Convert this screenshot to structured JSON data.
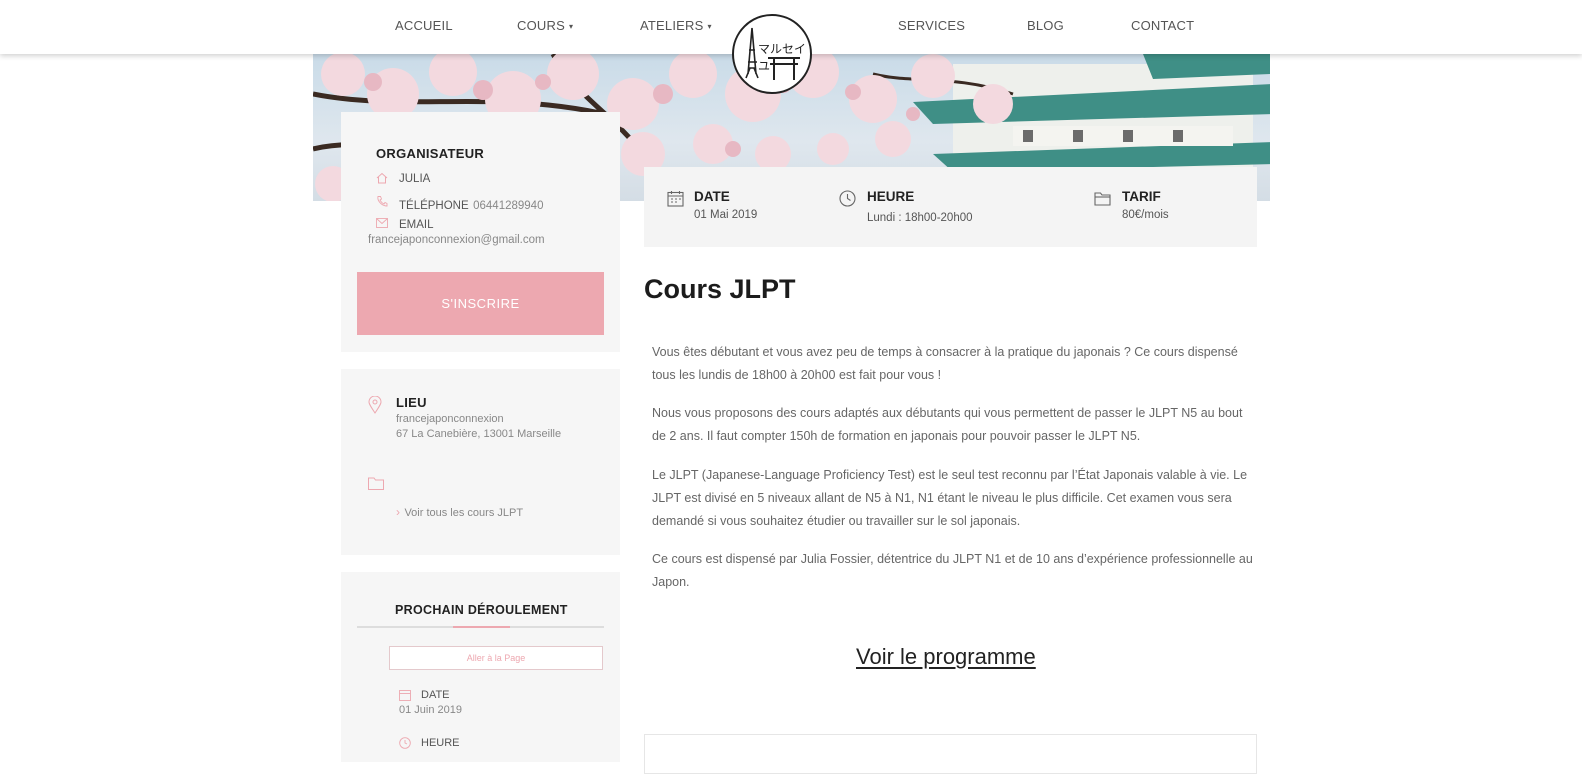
{
  "nav": {
    "items": [
      {
        "label": "ACCUEIL"
      },
      {
        "label": "COURS",
        "dropdown": true
      },
      {
        "label": "ATELIERS",
        "dropdown": true
      },
      {
        "label": "SERVICES"
      },
      {
        "label": "BLOG"
      },
      {
        "label": "CONTACT"
      }
    ],
    "caret": "▾"
  },
  "logo": {
    "text": "マルセイユ"
  },
  "organizer": {
    "heading": "ORGANISATEUR",
    "name": "JULIA",
    "phone_label": "TÉLÉPHONE",
    "phone_value": "06441289940",
    "email_label": "EMAIL",
    "email_value": "francejaponconnexion@gmail.com",
    "register_label": "S'INSCRIRE"
  },
  "lieu": {
    "heading": "LIEU",
    "name": "francejaponconnexion",
    "address": "67 La Canebière, 13001 Marseille",
    "all_courses_chevron": "›",
    "all_courses_link": "Voir tous les cours JLPT"
  },
  "prochain": {
    "heading": "PROCHAIN DÉROULEMENT",
    "goto_label": "Aller à la Page",
    "date_label": "DATE",
    "date_value": "01 Juin 2019",
    "heure_label": "HEURE"
  },
  "infobar": {
    "date_label": "DATE",
    "date_value": "01 Mai 2019",
    "heure_label": "HEURE",
    "heure_value": "Lundi : 18h00-20h00",
    "tarif_label": "TARIF",
    "tarif_value": "80€/mois"
  },
  "course": {
    "title": "Cours JLPT",
    "paragraphs": [
      "Vous êtes débutant et vous avez peu de temps à consacrer à la pratique du japonais ? Ce cours dispensé tous les lundis de 18h00 à 20h00 est fait pour vous !",
      "Nous vous proposons des cours adaptés aux débutants qui vous permettent de passer le JLPT N5  au bout de 2 ans. Il faut compter 150h de formation en japonais pour pouvoir passer le JLPT N5.",
      "Le JLPT (Japanese-Language Proficiency Test) est le seul test reconnu par l’État Japonais valable à vie. Le JLPT est divisé en 5 niveaux allant de N5 à N1,  N1 étant le niveau le plus difficile. Cet examen vous sera demandé si vous souhaitez étudier ou travailler sur le sol japonais.",
      "Ce cours est dispensé par Julia Fossier, détentrice du JLPT N1 et de 10 ans d’expérience professionnelle au Japon."
    ],
    "program_link": "Voir le programme"
  },
  "colors": {
    "accent": "#eda8b0",
    "card_bg": "#f6f6f6",
    "heading": "#222222"
  }
}
